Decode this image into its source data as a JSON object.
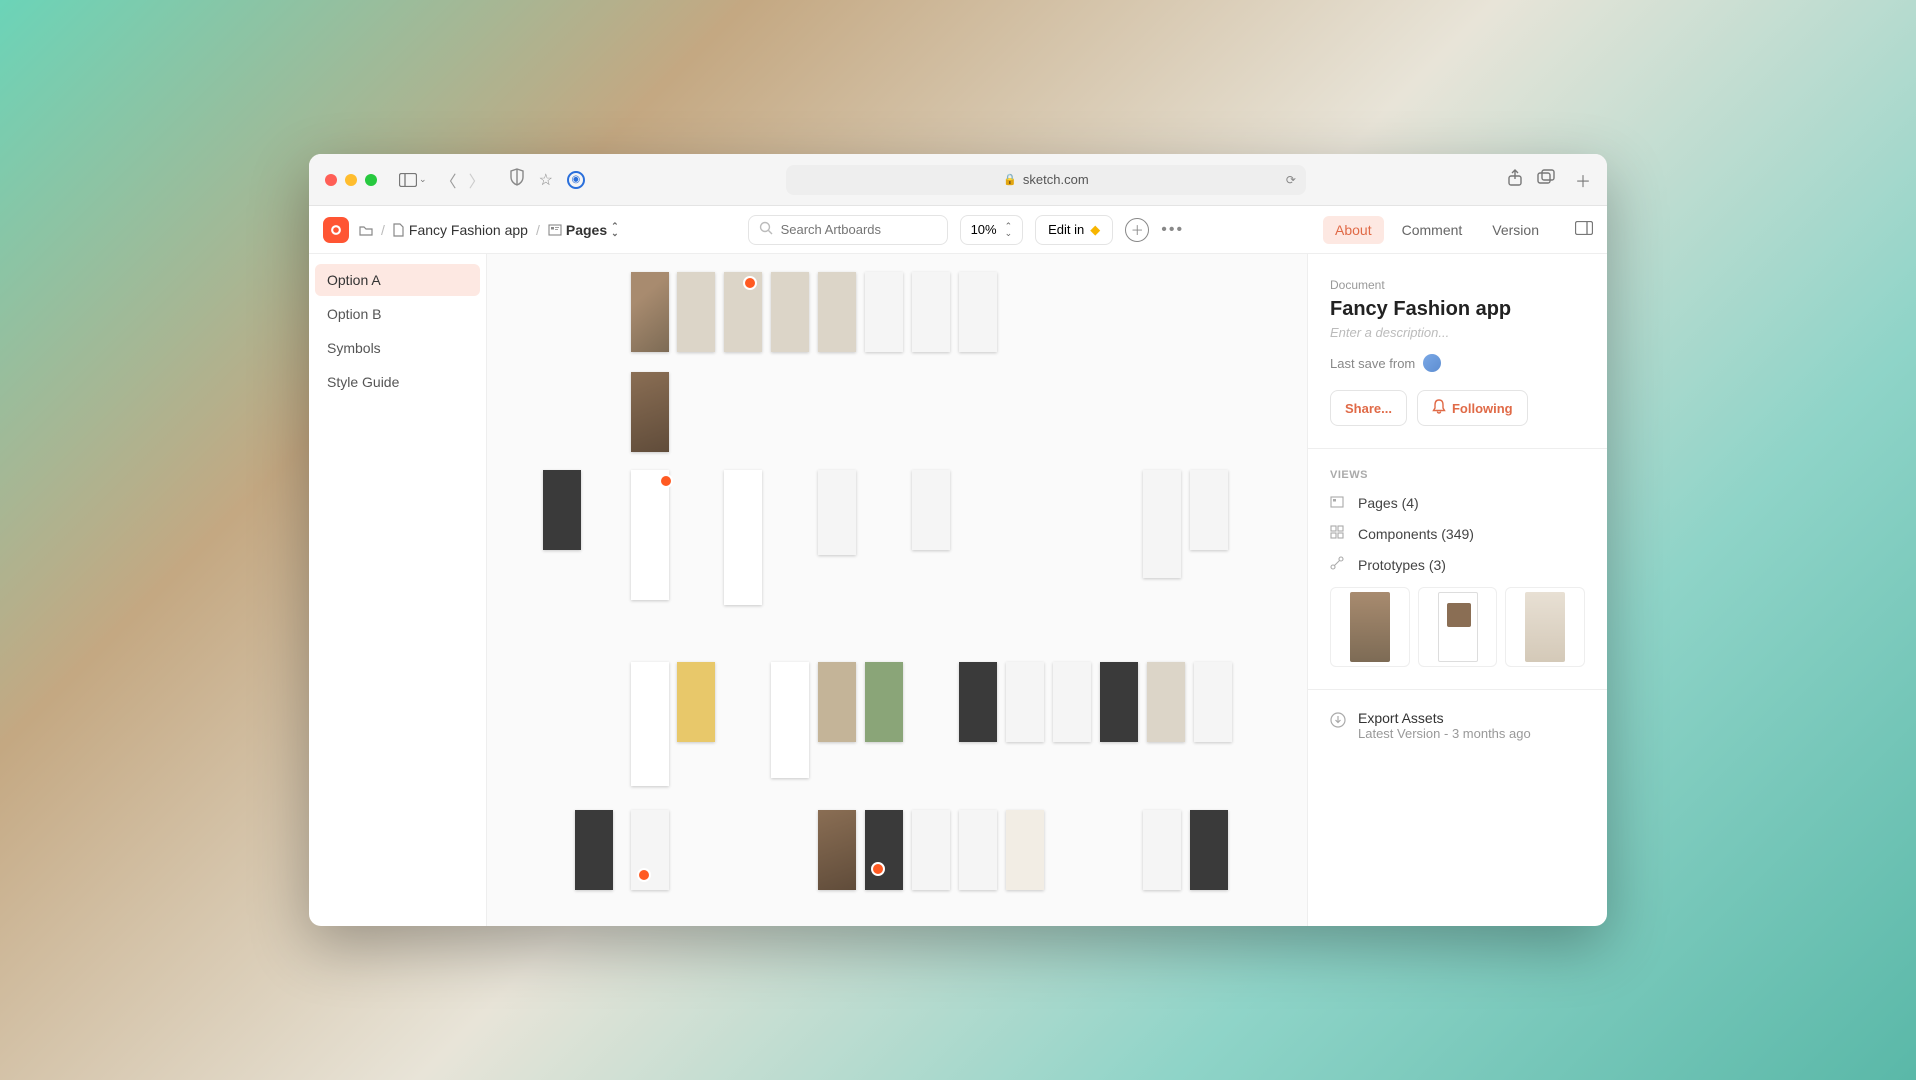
{
  "browser": {
    "url_host": "sketch.com"
  },
  "header": {
    "breadcrumb": {
      "doc": "Fancy Fashion app",
      "page": "Pages"
    },
    "search_placeholder": "Search Artboards",
    "zoom": "10%",
    "edit_label": "Edit in",
    "tabs": {
      "about": "About",
      "comment": "Comment",
      "version": "Version"
    }
  },
  "sidebar": {
    "items": [
      {
        "label": "Option A",
        "active": true
      },
      {
        "label": "Option B",
        "active": false
      },
      {
        "label": "Symbols",
        "active": false
      },
      {
        "label": "Style Guide",
        "active": false
      }
    ]
  },
  "panel": {
    "doc_label": "Document",
    "doc_name": "Fancy Fashion app",
    "desc_placeholder": "Enter a description...",
    "last_save": "Last save from",
    "share": "Share...",
    "following": "Following",
    "views_label": "VIEWS",
    "pages": "Pages (4)",
    "components": "Components (349)",
    "prototypes": "Prototypes (3)",
    "export_title": "Export Assets",
    "export_sub": "Latest Version - 3 months ago"
  }
}
